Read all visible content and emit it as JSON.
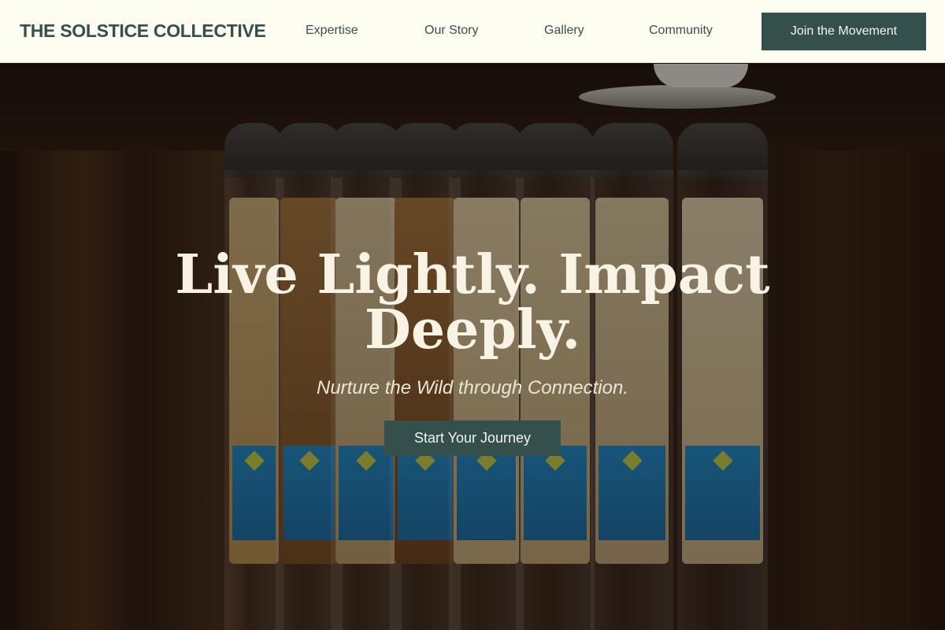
{
  "nav": {
    "brand": "THE SOLSTICE COLLECTIVE",
    "links": [
      {
        "label": "Expertise"
      },
      {
        "label": "Our Story"
      },
      {
        "label": "Gallery"
      },
      {
        "label": "Community"
      }
    ],
    "cta_label": "Join the Movement"
  },
  "hero": {
    "title": "Live Lightly. Impact Deeply.",
    "subtitle": "Nurture the Wild through Connection.",
    "cta_label": "Start Your Journey"
  },
  "colors": {
    "nav_background": "#fdfdf1",
    "brand_text": "#34504c",
    "button_background": "#34504c",
    "hero_title_text": "#f8f3e4"
  }
}
